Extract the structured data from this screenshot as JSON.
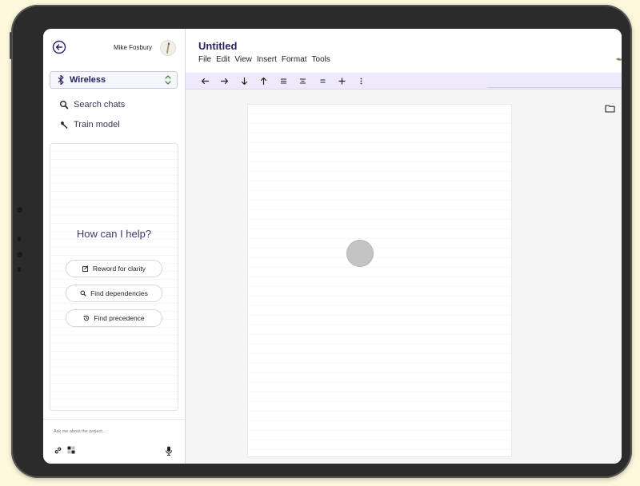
{
  "user": {
    "name": "Mike Fosbury"
  },
  "connection": {
    "label": "Wireless"
  },
  "nav": {
    "search_chats": "Search chats",
    "train_model": "Train model"
  },
  "assistant": {
    "prompt": "How can I help?",
    "suggestions": [
      "Reword for clarity",
      "Find dependencies",
      "Find precedence"
    ]
  },
  "composer": {
    "placeholder": "Ask me about the project..."
  },
  "document": {
    "title": "Untitled",
    "menu": [
      "File",
      "Edit",
      "View",
      "Insert",
      "Format",
      "Tools"
    ]
  },
  "colors": {
    "accent": "#2c1f63",
    "toolbar_bg": "#eeeafc",
    "device_frame": "#2b2b2b",
    "background": "#fdf8dc"
  },
  "icons": [
    "back-arrow-icon",
    "bluetooth-icon",
    "updown-chevron-icon",
    "search-icon",
    "wrench-icon",
    "edit-icon",
    "search-icon",
    "history-icon",
    "link-icon",
    "apps-icon",
    "mic-icon",
    "arrow-left-icon",
    "arrow-right-icon",
    "arrow-down-icon",
    "arrow-up-icon",
    "align-justify-icon",
    "align-center-icon",
    "equals-icon",
    "plus-icon",
    "more-vertical-icon",
    "folder-icon"
  ]
}
